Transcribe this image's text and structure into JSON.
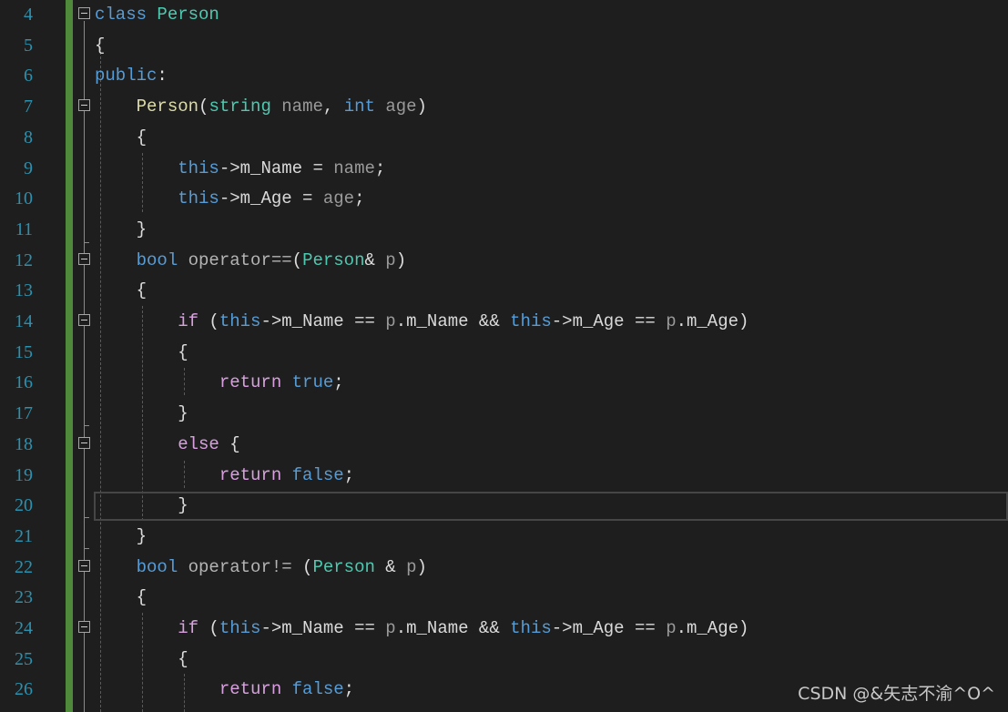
{
  "colors": {
    "background": "#1e1e1e",
    "line_number": "#2b91af",
    "keyword": "#569cd6",
    "type": "#4ec9b0",
    "function": "#dcdcaa",
    "parameter": "#9a9a9a",
    "control": "#d8a0df",
    "change_bar": "#4f8a3a"
  },
  "editor": {
    "current_line": 20,
    "lines": [
      {
        "n": "4",
        "tokens": [
          {
            "t": "class",
            "c": "kw"
          },
          {
            "t": " "
          },
          {
            "t": "Person",
            "c": "ty"
          }
        ]
      },
      {
        "n": "5",
        "tokens": [
          {
            "t": "{"
          }
        ]
      },
      {
        "n": "6",
        "tokens": [
          {
            "t": "public",
            "c": "kw"
          },
          {
            "t": ":"
          }
        ]
      },
      {
        "n": "7",
        "tokens": [
          {
            "t": "    "
          },
          {
            "t": "Person",
            "c": "fn"
          },
          {
            "t": "("
          },
          {
            "t": "string",
            "c": "ty"
          },
          {
            "t": " "
          },
          {
            "t": "name",
            "c": "pm"
          },
          {
            "t": ", "
          },
          {
            "t": "int",
            "c": "kw"
          },
          {
            "t": " "
          },
          {
            "t": "age",
            "c": "pm"
          },
          {
            "t": ")"
          }
        ]
      },
      {
        "n": "8",
        "tokens": [
          {
            "t": "    {"
          }
        ]
      },
      {
        "n": "9",
        "tokens": [
          {
            "t": "        "
          },
          {
            "t": "this",
            "c": "kw"
          },
          {
            "t": "->"
          },
          {
            "t": "m_Name",
            "c": "mb"
          },
          {
            "t": " = "
          },
          {
            "t": "name",
            "c": "pm"
          },
          {
            "t": ";"
          }
        ]
      },
      {
        "n": "10",
        "tokens": [
          {
            "t": "        "
          },
          {
            "t": "this",
            "c": "kw"
          },
          {
            "t": "->"
          },
          {
            "t": "m_Age",
            "c": "mb"
          },
          {
            "t": " = "
          },
          {
            "t": "age",
            "c": "pm"
          },
          {
            "t": ";"
          }
        ]
      },
      {
        "n": "11",
        "tokens": [
          {
            "t": "    }"
          }
        ]
      },
      {
        "n": "12",
        "tokens": [
          {
            "t": "    "
          },
          {
            "t": "bool",
            "c": "kw"
          },
          {
            "t": " "
          },
          {
            "t": "operator==",
            "c": "op"
          },
          {
            "t": "("
          },
          {
            "t": "Person",
            "c": "ty"
          },
          {
            "t": "& "
          },
          {
            "t": "p",
            "c": "pm"
          },
          {
            "t": ")"
          }
        ]
      },
      {
        "n": "13",
        "tokens": [
          {
            "t": "    {"
          }
        ]
      },
      {
        "n": "14",
        "tokens": [
          {
            "t": "        "
          },
          {
            "t": "if",
            "c": "ct"
          },
          {
            "t": " ("
          },
          {
            "t": "this",
            "c": "kw"
          },
          {
            "t": "->"
          },
          {
            "t": "m_Name",
            "c": "mb"
          },
          {
            "t": " == "
          },
          {
            "t": "p",
            "c": "pm"
          },
          {
            "t": "."
          },
          {
            "t": "m_Name",
            "c": "mb"
          },
          {
            "t": " && "
          },
          {
            "t": "this",
            "c": "kw"
          },
          {
            "t": "->"
          },
          {
            "t": "m_Age",
            "c": "mb"
          },
          {
            "t": " == "
          },
          {
            "t": "p",
            "c": "pm"
          },
          {
            "t": "."
          },
          {
            "t": "m_Age",
            "c": "mb"
          },
          {
            "t": ")"
          }
        ]
      },
      {
        "n": "15",
        "tokens": [
          {
            "t": "        {"
          }
        ]
      },
      {
        "n": "16",
        "tokens": [
          {
            "t": "            "
          },
          {
            "t": "return",
            "c": "ct"
          },
          {
            "t": " "
          },
          {
            "t": "true",
            "c": "kw"
          },
          {
            "t": ";"
          }
        ]
      },
      {
        "n": "17",
        "tokens": [
          {
            "t": "        }"
          }
        ]
      },
      {
        "n": "18",
        "tokens": [
          {
            "t": "        "
          },
          {
            "t": "else",
            "c": "ct"
          },
          {
            "t": " {"
          }
        ]
      },
      {
        "n": "19",
        "tokens": [
          {
            "t": "            "
          },
          {
            "t": "return",
            "c": "ct"
          },
          {
            "t": " "
          },
          {
            "t": "false",
            "c": "kw"
          },
          {
            "t": ";"
          }
        ]
      },
      {
        "n": "20",
        "tokens": [
          {
            "t": "        }"
          }
        ]
      },
      {
        "n": "21",
        "tokens": [
          {
            "t": "    }"
          }
        ]
      },
      {
        "n": "22",
        "tokens": [
          {
            "t": "    "
          },
          {
            "t": "bool",
            "c": "kw"
          },
          {
            "t": " "
          },
          {
            "t": "operator!=",
            "c": "op"
          },
          {
            "t": " ("
          },
          {
            "t": "Person",
            "c": "ty"
          },
          {
            "t": " & "
          },
          {
            "t": "p",
            "c": "pm"
          },
          {
            "t": ")"
          }
        ]
      },
      {
        "n": "23",
        "tokens": [
          {
            "t": "    {"
          }
        ]
      },
      {
        "n": "24",
        "tokens": [
          {
            "t": "        "
          },
          {
            "t": "if",
            "c": "ct"
          },
          {
            "t": " ("
          },
          {
            "t": "this",
            "c": "kw"
          },
          {
            "t": "->"
          },
          {
            "t": "m_Name",
            "c": "mb"
          },
          {
            "t": " == "
          },
          {
            "t": "p",
            "c": "pm"
          },
          {
            "t": "."
          },
          {
            "t": "m_Name",
            "c": "mb"
          },
          {
            "t": " && "
          },
          {
            "t": "this",
            "c": "kw"
          },
          {
            "t": "->"
          },
          {
            "t": "m_Age",
            "c": "mb"
          },
          {
            "t": " == "
          },
          {
            "t": "p",
            "c": "pm"
          },
          {
            "t": "."
          },
          {
            "t": "m_Age",
            "c": "mb"
          },
          {
            "t": ")"
          }
        ]
      },
      {
        "n": "25",
        "tokens": [
          {
            "t": "        {"
          }
        ]
      },
      {
        "n": "26",
        "tokens": [
          {
            "t": "            "
          },
          {
            "t": "return",
            "c": "ct"
          },
          {
            "t": " "
          },
          {
            "t": "false",
            "c": "kw"
          },
          {
            "t": ";"
          }
        ]
      }
    ]
  },
  "watermark": "CSDN @&矢志不渝^O^"
}
